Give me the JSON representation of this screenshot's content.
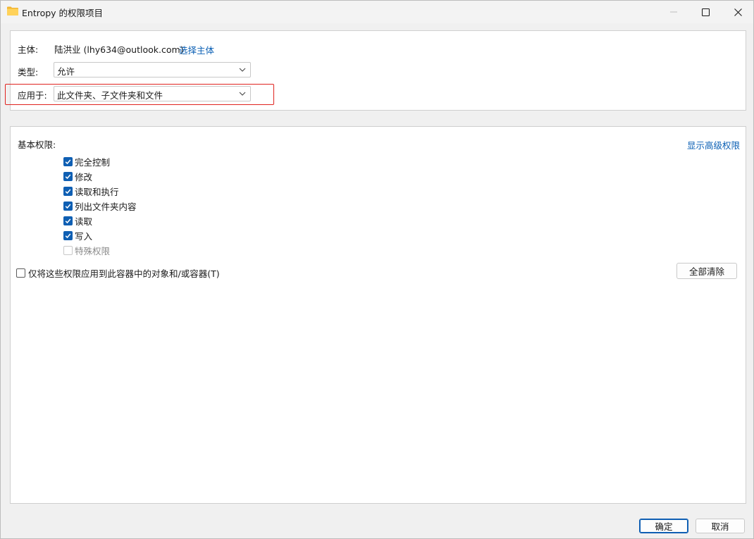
{
  "window": {
    "title": "Entropy 的权限项目",
    "controls": [
      "minimize-icon",
      "maximize-icon",
      "close-icon"
    ]
  },
  "principal": {
    "label": "主体:",
    "value": "陆洪业 (lhy634@outlook.com)",
    "select_link": "选择主体"
  },
  "type": {
    "label": "类型:",
    "value": "允许"
  },
  "applies_to": {
    "label": "应用于:",
    "value": "此文件夹、子文件夹和文件"
  },
  "basic_permissions": {
    "heading": "基本权限:",
    "advanced_link": "显示高级权限",
    "items": [
      {
        "label": "完全控制",
        "checked": true,
        "enabled": true
      },
      {
        "label": "修改",
        "checked": true,
        "enabled": true
      },
      {
        "label": "读取和执行",
        "checked": true,
        "enabled": true
      },
      {
        "label": "列出文件夹内容",
        "checked": true,
        "enabled": true
      },
      {
        "label": "读取",
        "checked": true,
        "enabled": true
      },
      {
        "label": "写入",
        "checked": true,
        "enabled": true
      },
      {
        "label": "特殊权限",
        "checked": false,
        "enabled": false
      }
    ],
    "container_only_label": "仅将这些权限应用到此容器中的对象和/或容器(T)",
    "container_only_checked": false,
    "clear_all": "全部清除"
  },
  "footer": {
    "ok": "确定",
    "cancel": "取消"
  },
  "colors": {
    "accent": "#0f5fb3",
    "link": "#0a5fb4",
    "highlight": "#e0231f"
  }
}
